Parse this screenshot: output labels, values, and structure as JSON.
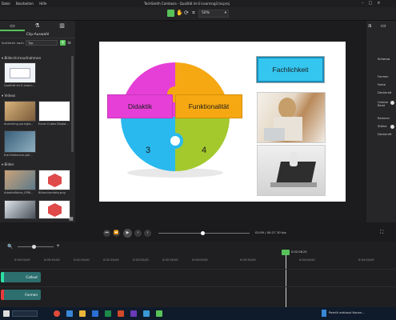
{
  "window": {
    "title": "TechSmith Camtasia - Qualität im E-Learning3.tscproj",
    "menu": [
      "Datei",
      "Bearbeiten",
      "Hilfe"
    ],
    "zoom": "50%"
  },
  "left_panel": {
    "title": "Clip-Auswahl",
    "sort_label": "Sortieren nach",
    "sort_value": "Typ",
    "sections": {
      "recordings": "Bildschirmaufnahmen",
      "videos": "Videos",
      "images": "Bilder"
    },
    "recording_items": [
      "Qualität im E-Learn..."
    ],
    "video_items": [
      "eLearning-youngw...",
      "Excel-Cubes Displa...",
      "the-freelancer-girl..."
    ],
    "image_items": [
      "Arbeitsfläche_EPIK...",
      "Bildschirmfoto.png",
      "",
      ""
    ]
  },
  "slide": {
    "puzzle": {
      "label_left": "Didaktik",
      "label_right": "Funktionalität",
      "number_3": "3",
      "number_4": "4"
    },
    "callout": "Fachlichkeit"
  },
  "right_panel": {
    "tabs": [
      "Schema",
      "Stil"
    ],
    "labels": [
      "Formen",
      "Farbe",
      "Deckkraft",
      "Unterer Rand",
      "Rahmen",
      "Stärke",
      "Deckkraft"
    ]
  },
  "playback": {
    "time": "02:09 / 00:27",
    "fps": "30 fps",
    "playhead_ratio": 0.48
  },
  "timeline": {
    "ticks": [
      "0:00:00;00",
      "0:00:30;00",
      "0:01:00;00",
      "0:01:30;00",
      "0:02:00;00",
      "0:02:30;00",
      "0:03:00;00",
      "0:03:30;00",
      "0:04:00;00",
      "0:04:30;00"
    ],
    "playhead_label": "0:02:08;25",
    "tracks": [
      {
        "name": "Callout",
        "color": "#2d6e6e"
      },
      {
        "name": "Formen",
        "color": "#2d6e6e"
      }
    ]
  },
  "taskbar": {
    "notification": "Peerlit entlasst Konze..."
  },
  "colors": {
    "accent_green": "#58c25a",
    "puzzle_magenta": "#e63fd7",
    "puzzle_orange": "#f6a812",
    "puzzle_cyan": "#29b9ee",
    "puzzle_green": "#a3c92d",
    "callout_bg": "#35c6f0"
  }
}
